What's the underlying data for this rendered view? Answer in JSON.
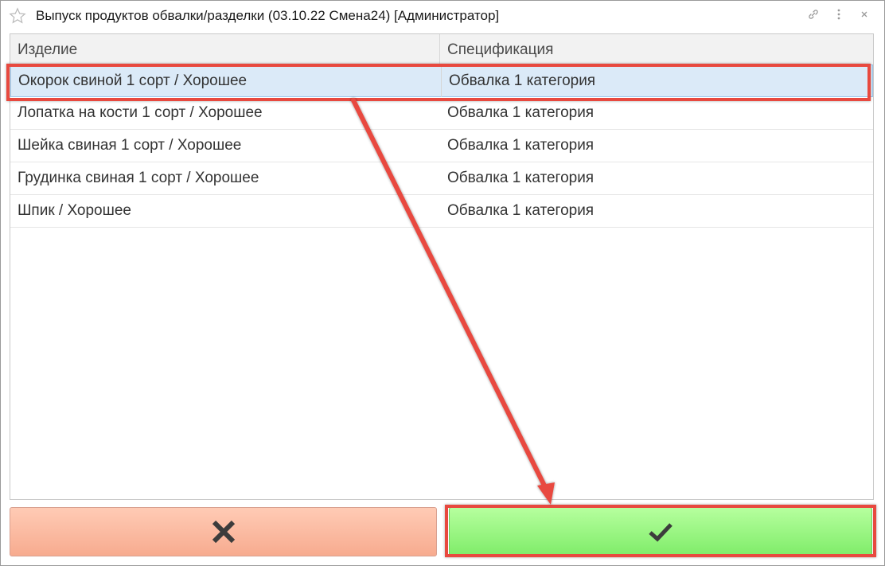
{
  "window": {
    "title": "Выпуск продуктов обвалки/разделки (03.10.22 Смена24) [Администратор]"
  },
  "table": {
    "headers": [
      "Изделие",
      "Спецификация"
    ],
    "rows": [
      {
        "product": "Окорок свиной 1 сорт / Хорошее",
        "spec": "Обвалка 1 категория"
      },
      {
        "product": "Лопатка на кости 1 сорт / Хорошее",
        "spec": "Обвалка 1 категория"
      },
      {
        "product": "Шейка свиная 1 сорт / Хорошее",
        "spec": "Обвалка 1 категория"
      },
      {
        "product": "Грудинка свиная 1 сорт / Хорошее",
        "spec": "Обвалка 1 категория"
      },
      {
        "product": "Шпик / Хорошее",
        "spec": "Обвалка 1 категория"
      }
    ],
    "selected_row": 0
  },
  "buttons": {
    "cancel_icon": "close-x-icon",
    "ok_icon": "checkmark-icon"
  },
  "colors": {
    "annotation": "#e8493f",
    "cancel_bg": "#f7ab8f",
    "ok_bg": "#7fec69",
    "selected_row": "#dbeaf8"
  }
}
